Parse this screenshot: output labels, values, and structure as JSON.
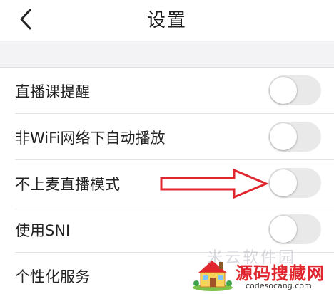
{
  "header": {
    "title": "设置"
  },
  "settings": {
    "items": [
      {
        "label": "直播课提醒",
        "has_toggle": true,
        "toggle_on": false
      },
      {
        "label": "非WiFi网络下自动播放",
        "has_toggle": true,
        "toggle_on": false
      },
      {
        "label": "不上麦直播模式",
        "has_toggle": true,
        "toggle_on": false
      },
      {
        "label": "使用SNI",
        "has_toggle": true,
        "toggle_on": false
      },
      {
        "label": "个性化服务",
        "has_toggle": false
      }
    ]
  },
  "annotation": {
    "arrow_color": "#e0262e"
  },
  "watermark": {
    "faint_text": "米云软件园",
    "main_text": "源码搜藏网",
    "url": "codesocang.com"
  },
  "colors": {
    "toggle_off_track": "#e9e9ea",
    "background_band": "#f3f3f6",
    "text": "#222222"
  }
}
